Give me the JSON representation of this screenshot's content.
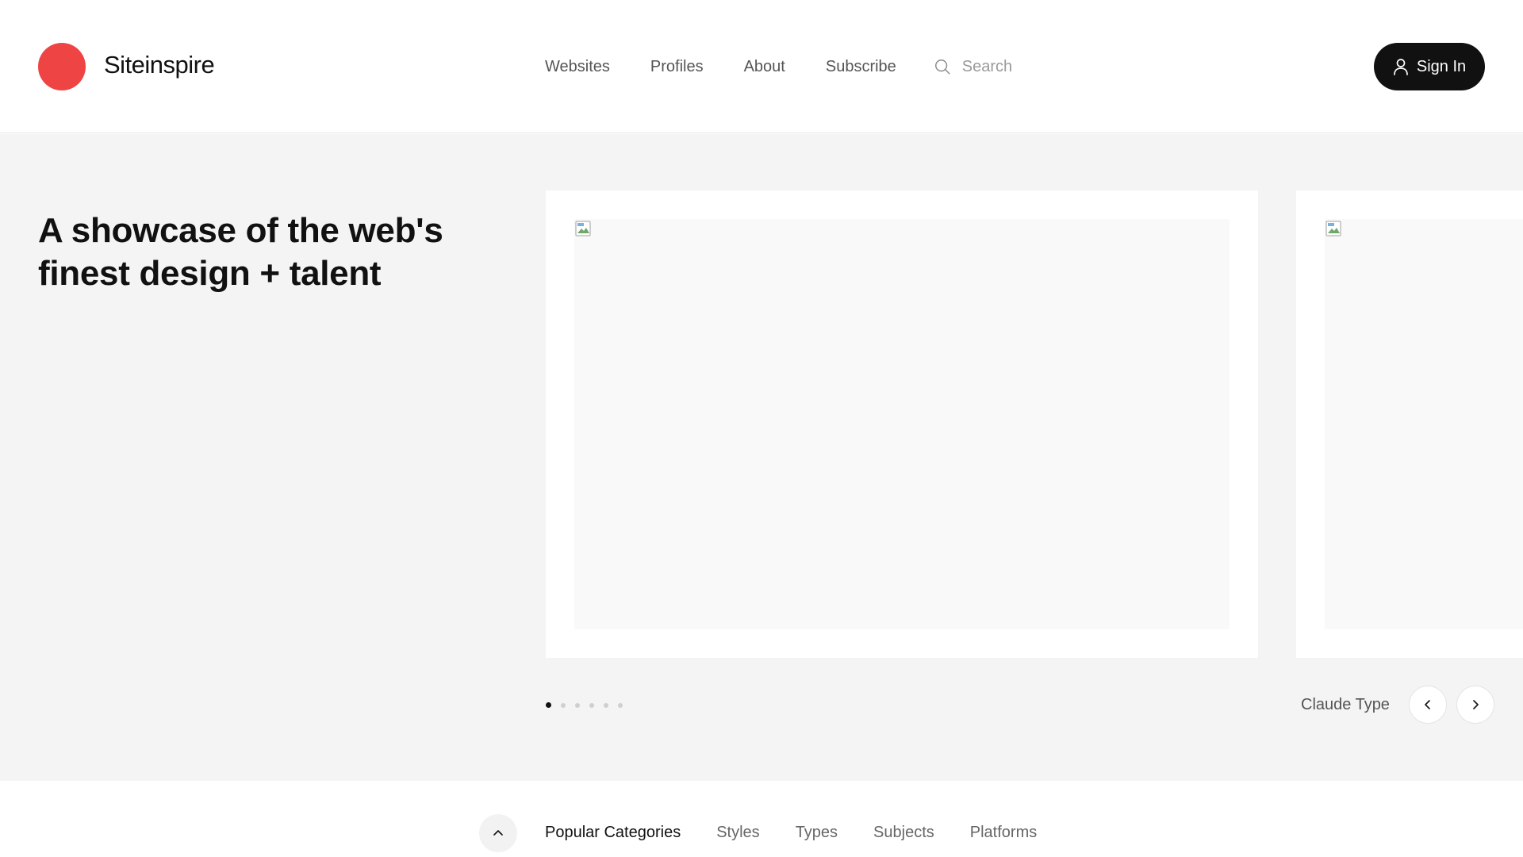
{
  "brand": {
    "name": "Siteinspire",
    "accent_color": "#ef4444"
  },
  "nav": {
    "items": [
      {
        "label": "Websites"
      },
      {
        "label": "Profiles"
      },
      {
        "label": "About"
      },
      {
        "label": "Subscribe"
      }
    ],
    "search_placeholder": "Search",
    "search_icon": "search-icon"
  },
  "header": {
    "signin_label": "Sign In",
    "signin_icon": "user-icon"
  },
  "hero": {
    "title": "A showcase of the web's finest design + talent",
    "carousel": {
      "slide_count": 6,
      "active_index": 0,
      "current_label": "Claude Type"
    }
  },
  "categories": {
    "tabs": [
      {
        "label": "Popular Categories",
        "active": true
      },
      {
        "label": "Styles",
        "active": false
      },
      {
        "label": "Types",
        "active": false
      },
      {
        "label": "Subjects",
        "active": false
      },
      {
        "label": "Platforms",
        "active": false
      }
    ]
  }
}
